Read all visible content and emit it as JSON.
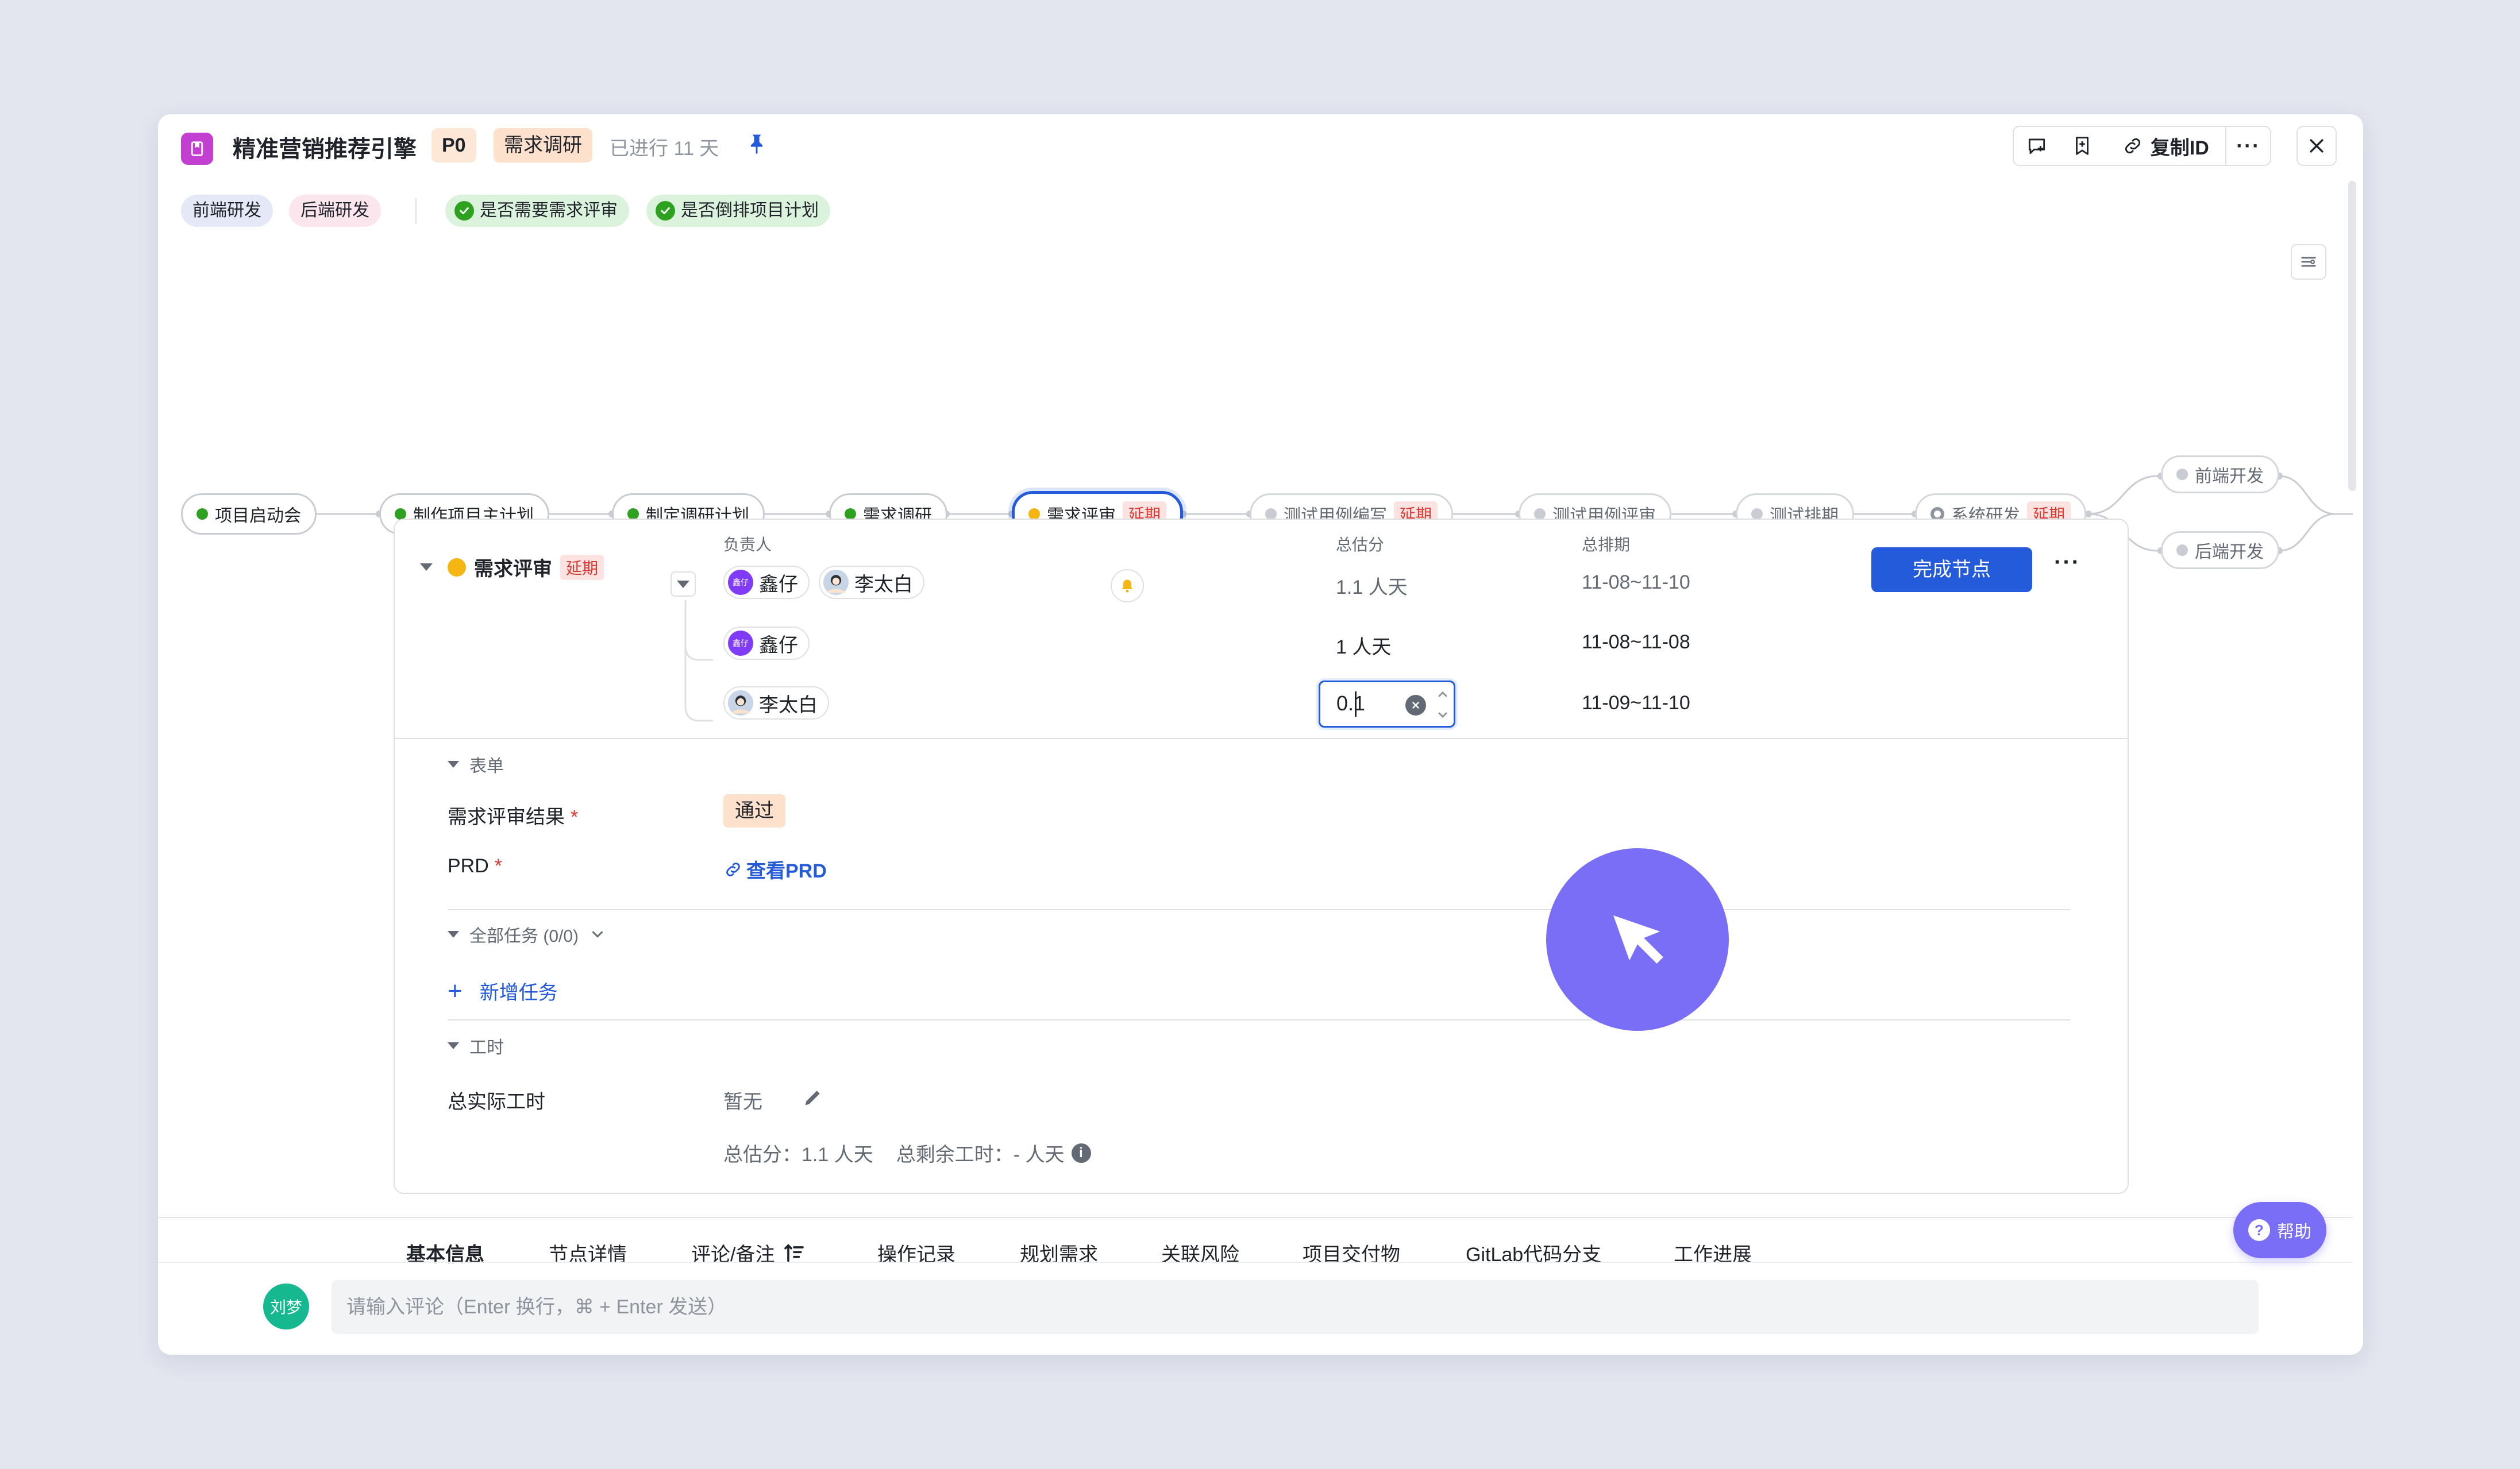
{
  "header": {
    "title": "精准营销推荐引擎",
    "priority": "P0",
    "stage": "需求调研",
    "elapsed": "已进行 11 天",
    "copy_id_label": "复制ID",
    "more_label": "···"
  },
  "tags": {
    "frontend": "前端研发",
    "backend": "后端研发",
    "check1": "是否需要需求评审",
    "check2": "是否倒排项目计划"
  },
  "flow": {
    "delay_label": "延期",
    "nodes": [
      {
        "label": "项目启动会",
        "status": "done"
      },
      {
        "label": "制作项目主计划",
        "status": "done"
      },
      {
        "label": "制定调研计划",
        "status": "done"
      },
      {
        "label": "需求调研",
        "status": "done"
      },
      {
        "label": "需求评审",
        "status": "active",
        "delayed": true
      },
      {
        "label": "测试用例编写",
        "status": "pending",
        "delayed": true
      },
      {
        "label": "测试用例评审",
        "status": "pending"
      },
      {
        "label": "测试排期",
        "status": "pending"
      },
      {
        "label": "系统研发",
        "status": "in-progress",
        "delayed": true
      },
      {
        "label": "前端开发",
        "status": "pending"
      },
      {
        "label": "后端开发",
        "status": "pending"
      }
    ]
  },
  "detail": {
    "node_name": "需求评审",
    "delay_label": "延期",
    "col_owner": "负责人",
    "col_estimate": "总估分",
    "col_schedule": "总排期",
    "rows": [
      {
        "owners": [
          "鑫仔",
          "李太白"
        ],
        "estimate": "1.1 人天",
        "schedule": "11-08~11-10"
      },
      {
        "owners": [
          "鑫仔"
        ],
        "estimate": "1 人天",
        "schedule": "11-08~11-08"
      },
      {
        "owners": [
          "李太白"
        ],
        "estimate_input": "0.1",
        "schedule": "11-09~11-10"
      }
    ],
    "avatar_xz": "鑫仔",
    "complete_btn": "完成节点",
    "more": "···"
  },
  "form": {
    "section": "表单",
    "review_result_label": "需求评审结果",
    "review_result_value": "通过",
    "prd_label": "PRD",
    "prd_link": "查看PRD",
    "required_mark": "*"
  },
  "tasks": {
    "section": "全部任务 (0/0)",
    "add_label": "新增任务"
  },
  "worktime": {
    "section": "工时",
    "actual_label": "总实际工时",
    "actual_value": "暂无",
    "summary_estimate": "总估分：1.1 人天",
    "summary_remaining": "总剩余工时：- 人天"
  },
  "tabs": [
    "基本信息",
    "节点详情",
    "评论/备注",
    "操作记录",
    "规划需求",
    "关联风险",
    "项目交付物",
    "GitLab代码分支",
    "工作进展"
  ],
  "help_label": "帮助",
  "comment": {
    "avatar": "刘梦",
    "placeholder": "请输入评论（Enter 换行，⌘ + Enter 发送）"
  }
}
